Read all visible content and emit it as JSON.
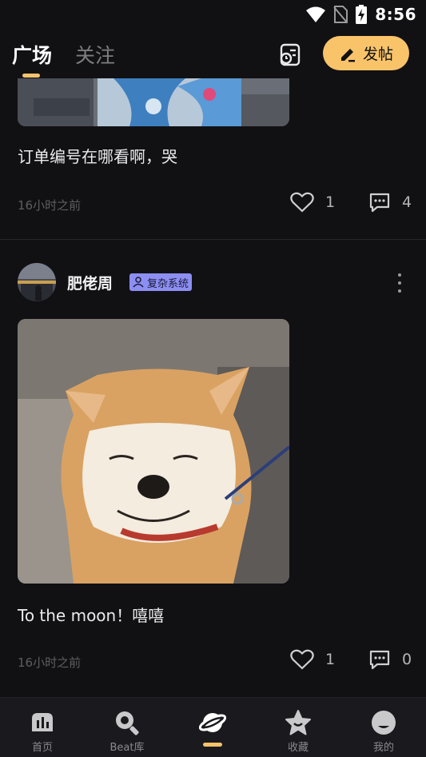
{
  "status_bar": {
    "time": "8:56"
  },
  "header": {
    "tabs": [
      {
        "label": "广场",
        "active": true
      },
      {
        "label": "关注",
        "active": false
      }
    ],
    "post_button_label": "发帖",
    "accent_color": "#f9c36a"
  },
  "feed": {
    "posts": [
      {
        "text": "订单编号在哪看啊，哭",
        "time": "16小时之前",
        "likes": "1",
        "comments": "4"
      },
      {
        "username": "肥佬周",
        "badge": "复杂系统",
        "text": "To the moon！嘻嘻",
        "time": "16小时之前",
        "likes": "1",
        "comments": "0"
      }
    ]
  },
  "bottom_nav": {
    "items": [
      {
        "label": "首页",
        "icon": "home-chart-icon"
      },
      {
        "label": "Beat库",
        "icon": "search-icon"
      },
      {
        "label": "",
        "icon": "planet-icon",
        "active": true
      },
      {
        "label": "收藏",
        "icon": "star-icon"
      },
      {
        "label": "我的",
        "icon": "profile-icon"
      }
    ]
  }
}
